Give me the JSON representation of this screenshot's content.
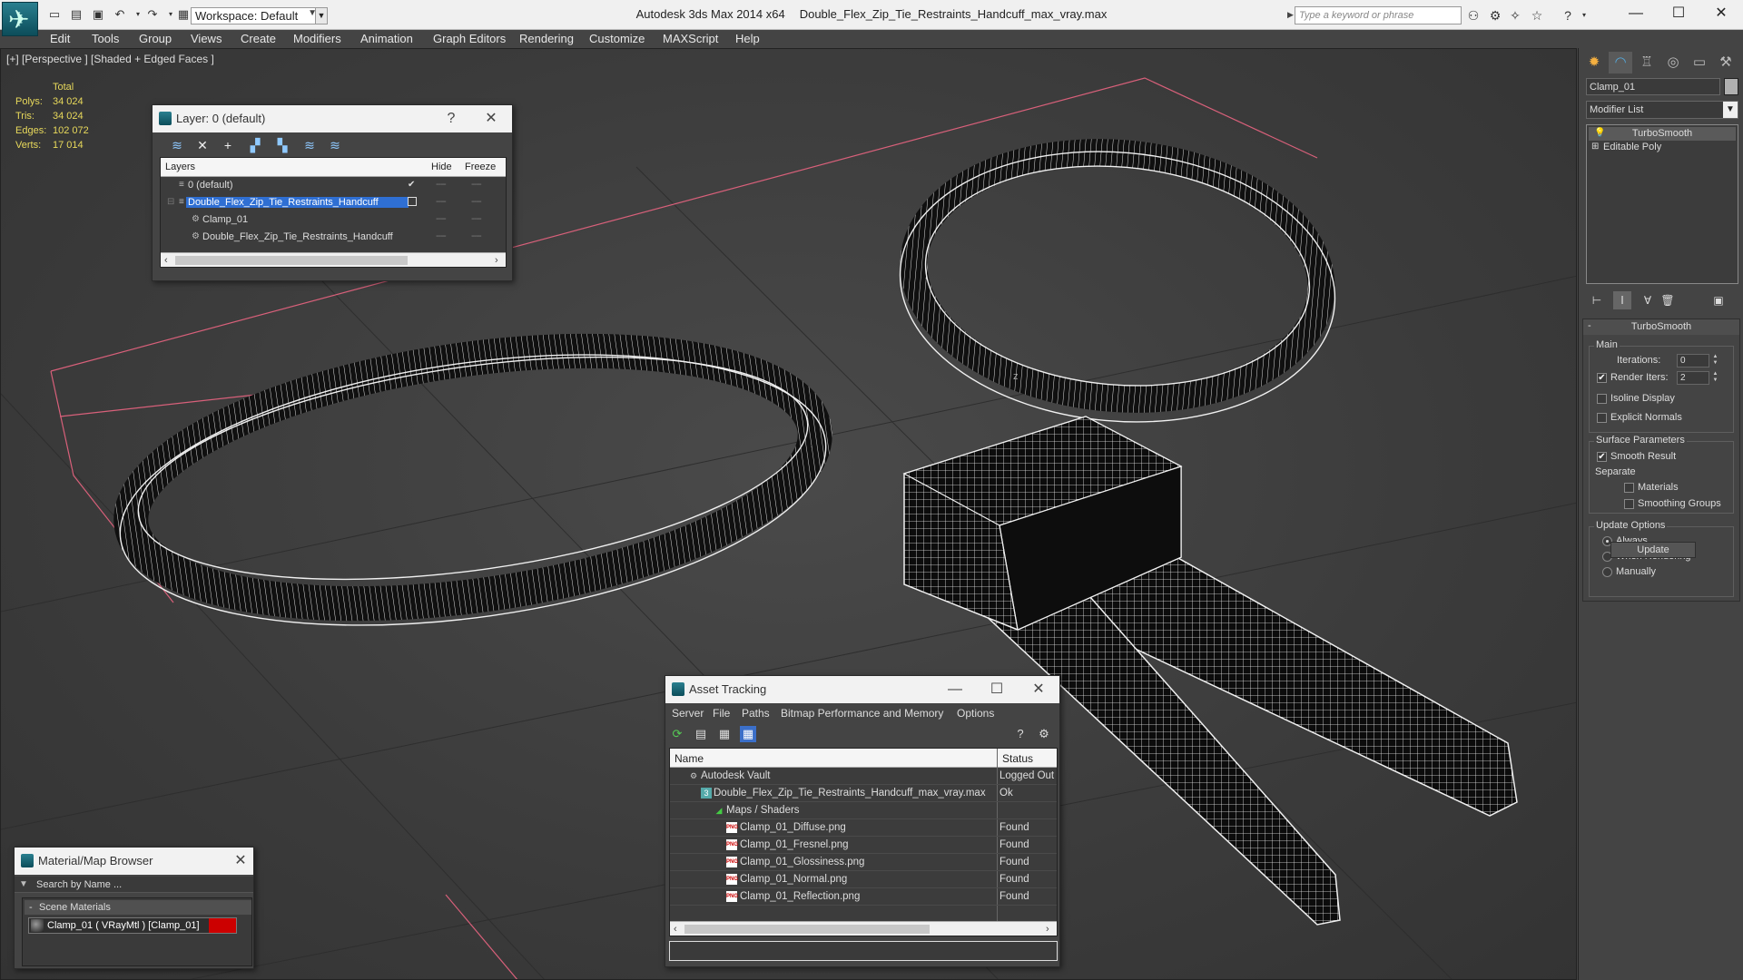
{
  "titlebar": {
    "workspace": "Workspace: Default",
    "app_name": "Autodesk 3ds Max  2014 x64",
    "file_name": "Double_Flex_Zip_Tie_Restraints_Handcuff_max_vray.max",
    "search_placeholder": "Type a keyword or phrase",
    "minimize": "—",
    "maximize": "☐",
    "close": "✕"
  },
  "menu": [
    "Edit",
    "Tools",
    "Group",
    "Views",
    "Create",
    "Modifiers",
    "Animation",
    "Graph Editors",
    "Rendering",
    "Customize",
    "MAXScript",
    "Help"
  ],
  "viewport": {
    "label": "[+] [Perspective ] [Shaded + Edged Faces ]",
    "stats": {
      "header": "Total",
      "rows": [
        {
          "label": "Polys:",
          "value": "34 024"
        },
        {
          "label": "Tris:",
          "value": "34 024"
        },
        {
          "label": "Edges:",
          "value": "102 072"
        },
        {
          "label": "Verts:",
          "value": "17 014"
        }
      ]
    },
    "axis_label": "z"
  },
  "layer_panel": {
    "title": "Layer: 0 (default)",
    "help": "?",
    "close": "✕",
    "columns": {
      "layers": "Layers",
      "hide": "Hide",
      "freeze": "Freeze"
    },
    "rows": [
      {
        "name": "0 (default)"
      },
      {
        "name": "Double_Flex_Zip_Tie_Restraints_Handcuff"
      },
      {
        "name": "Clamp_01"
      },
      {
        "name": "Double_Flex_Zip_Tie_Restraints_Handcuff"
      }
    ],
    "dash": "----",
    "check": "✔"
  },
  "material_browser": {
    "title": "Material/Map Browser",
    "close": "✕",
    "search": "Search by Name ...",
    "group": "Scene Materials",
    "group_toggle": "-",
    "item": "Clamp_01  ( VRayMtl )  [Clamp_01]"
  },
  "asset_tracking": {
    "title": "Asset Tracking",
    "menu": [
      "Server",
      "File",
      "Paths",
      "Bitmap Performance and Memory",
      "Options"
    ],
    "columns": {
      "name": "Name",
      "status": "Status"
    },
    "rows": [
      {
        "name": "Autodesk Vault",
        "status": "Logged Out"
      },
      {
        "name": "Double_Flex_Zip_Tie_Restraints_Handcuff_max_vray.max",
        "status": "Ok"
      },
      {
        "name": "Maps / Shaders",
        "status": ""
      },
      {
        "name": "Clamp_01_Diffuse.png",
        "status": "Found"
      },
      {
        "name": "Clamp_01_Fresnel.png",
        "status": "Found"
      },
      {
        "name": "Clamp_01_Glossiness.png",
        "status": "Found"
      },
      {
        "name": "Clamp_01_Normal.png",
        "status": "Found"
      },
      {
        "name": "Clamp_01_Reflection.png",
        "status": "Found"
      }
    ],
    "png_tag": "PNG",
    "minimize": "—",
    "maximize": "☐",
    "close": "✕"
  },
  "command_panel": {
    "object_name": "Clamp_01",
    "modifier_list": "Modifier List",
    "stack": [
      "TurboSmooth",
      "Editable Poly"
    ],
    "rollout_title": "TurboSmooth",
    "rollout_toggle": "-",
    "main_group": "Main",
    "iterations_label": "Iterations:",
    "iterations_value": "0",
    "render_iters_label": "Render Iters:",
    "render_iters_value": "2",
    "render_iters_checked": true,
    "isoline_label": "Isoline Display",
    "explicit_normals_label": "Explicit Normals",
    "surface_group": "Surface Parameters",
    "smooth_result_label": "Smooth Result",
    "smooth_result_checked": true,
    "separate_label": "Separate",
    "materials_label": "Materials",
    "smoothing_groups_label": "Smoothing Groups",
    "update_group": "Update Options",
    "update_options": [
      "Always",
      "When Rendering",
      "Manually"
    ],
    "update_selected": "Always",
    "update_button": "Update"
  },
  "colors": {
    "selection": "#2f6fd3",
    "stats_text": "#e8d95b",
    "grid_red": "#d8607a"
  }
}
